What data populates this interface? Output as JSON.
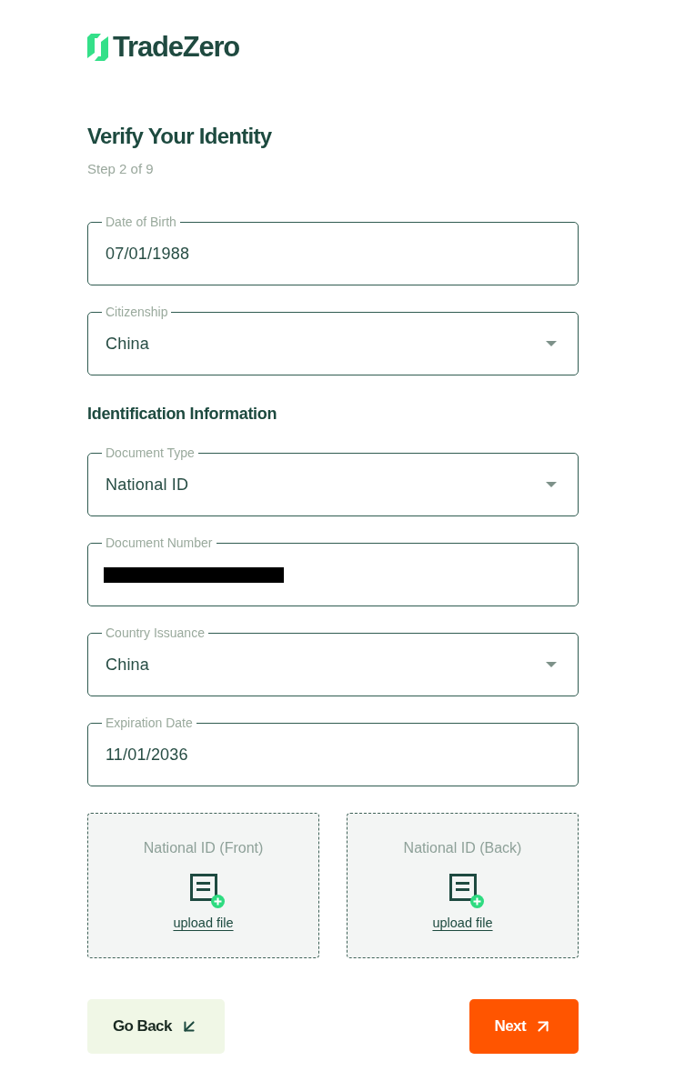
{
  "logo": {
    "text": "TradeZero"
  },
  "header": {
    "title": "Verify Your Identity",
    "step": "Step 2 of 9"
  },
  "personal_fields": [
    {
      "kind": "text",
      "label": "Date of Birth",
      "value": "07/01/1988"
    },
    {
      "kind": "select",
      "label": "Citizenship",
      "value": "China"
    }
  ],
  "section_title": "Identification Information",
  "id_fields": [
    {
      "kind": "select",
      "label": "Document Type",
      "value": "National ID"
    },
    {
      "kind": "redacted",
      "label": "Document Number"
    },
    {
      "kind": "select",
      "label": "Country Issuance",
      "value": "China"
    },
    {
      "kind": "text",
      "label": "Expiration Date",
      "value": "11/01/2036"
    }
  ],
  "uploads": [
    {
      "title": "National ID (Front)",
      "link": "upload file"
    },
    {
      "title": "National ID (Back)",
      "link": "upload file"
    }
  ],
  "buttons": [
    {
      "kind": "back",
      "label": "Go Back"
    },
    {
      "kind": "next",
      "label": "Next"
    }
  ]
}
